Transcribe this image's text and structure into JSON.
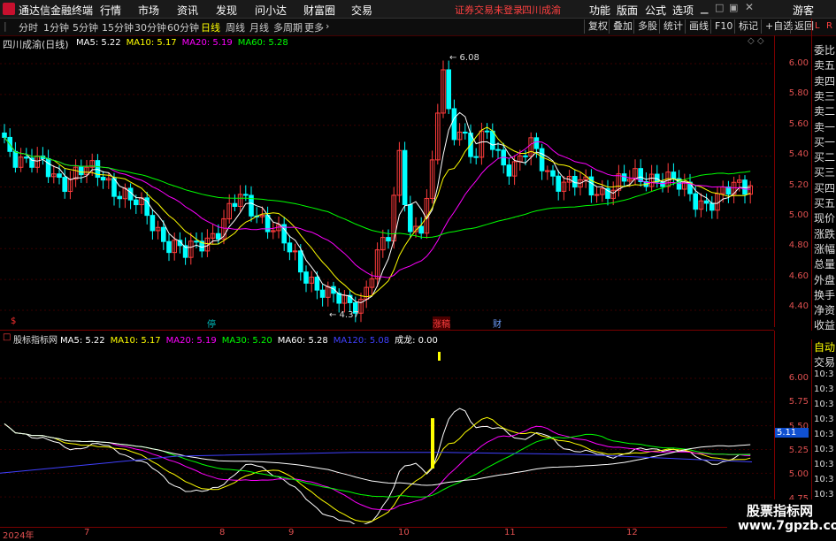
{
  "app": {
    "title": "通达信金融终端"
  },
  "menu": {
    "items": [
      "行情",
      "市场",
      "资讯",
      "发现",
      "问小达",
      "财富圈",
      "交易"
    ],
    "notice": "证券交易未登录",
    "stock_name_top": "四川成渝",
    "right_items": [
      "功能",
      "版面",
      "公式",
      "选项"
    ],
    "guest": "游客"
  },
  "toolbar": {
    "periods": [
      "分时",
      "1分钟",
      "5分钟",
      "15分钟",
      "30分钟",
      "60分钟",
      "日线",
      "周线",
      "月线",
      "多周期",
      "更多"
    ],
    "selected": "日线",
    "right": [
      "复权",
      "叠加",
      "多股",
      "统计",
      "画线",
      "F10",
      "标记",
      "+自选",
      "返回"
    ]
  },
  "main_chart": {
    "title": "四川成渝(日线)",
    "ma_labels": [
      {
        "text": "MA5: 5.22",
        "color": "#ffffff"
      },
      {
        "text": "MA10: 5.17",
        "color": "#ffff00"
      },
      {
        "text": "MA20: 5.19",
        "color": "#ff00ff"
      },
      {
        "text": "MA60: 5.28",
        "color": "#00ff00"
      }
    ],
    "price_ticks": [
      "6.00",
      "5.80",
      "5.60",
      "5.40",
      "5.20",
      "5.00",
      "4.80",
      "4.60",
      "4.40"
    ],
    "high_label": "6.08",
    "low_label": "4.37",
    "markers": [
      {
        "text": "$",
        "color": "#ff3030"
      },
      {
        "text": "停",
        "color": "#00c0c0"
      },
      {
        "text": "涨稿",
        "color": "#ff4040"
      },
      {
        "text": "财",
        "color": "#6f9fff"
      }
    ]
  },
  "indicator": {
    "title": "股标指标网",
    "labels": [
      {
        "text": "MA5: 5.22",
        "color": "#ffffff"
      },
      {
        "text": "MA10: 5.17",
        "color": "#ffff00"
      },
      {
        "text": "MA20: 5.19",
        "color": "#ff00ff"
      },
      {
        "text": "MA30: 5.20",
        "color": "#00ff00"
      },
      {
        "text": "MA60: 5.28",
        "color": "#ffffff"
      },
      {
        "text": "MA120: 5.08",
        "color": "#4040ff"
      },
      {
        "text": "成龙: 0.00",
        "color": "#ffffff"
      }
    ],
    "ticks": [
      "6.00",
      "5.75",
      "5.50",
      "5.25",
      "5.00",
      "4.75"
    ],
    "current_value": "5.11"
  },
  "sidebar_top": {
    "header_letters": [
      "L",
      "R"
    ],
    "items": [
      "委比",
      "卖五",
      "卖四",
      "卖三",
      "卖二",
      "卖一",
      "买一",
      "买二",
      "买三",
      "买四",
      "买五",
      "现价",
      "涨跌",
      "涨幅",
      "总量",
      "外盘",
      "换手",
      "净资",
      "收益"
    ]
  },
  "sidebar_bottom": {
    "items": [
      "自动",
      "交易",
      "10:3",
      "10:3",
      "10:3",
      "10:3",
      "10:3",
      "10:3",
      "10:3",
      "10:3",
      "10:3",
      "10:3",
      "10:3"
    ]
  },
  "bottom_axis": {
    "dates": [
      "2024年",
      "7",
      "8",
      "9",
      "10",
      "11",
      "12"
    ]
  },
  "watermark": {
    "line1": "股票指标网",
    "line2": "www.7gpzb.com"
  },
  "colors": {
    "up": "#ff3c3c",
    "down": "#00ffff",
    "ma5": "#ffffff",
    "ma10": "#ffff00",
    "ma20": "#ff00ff",
    "ma60": "#00ff00",
    "ma120": "#4040ff"
  }
}
